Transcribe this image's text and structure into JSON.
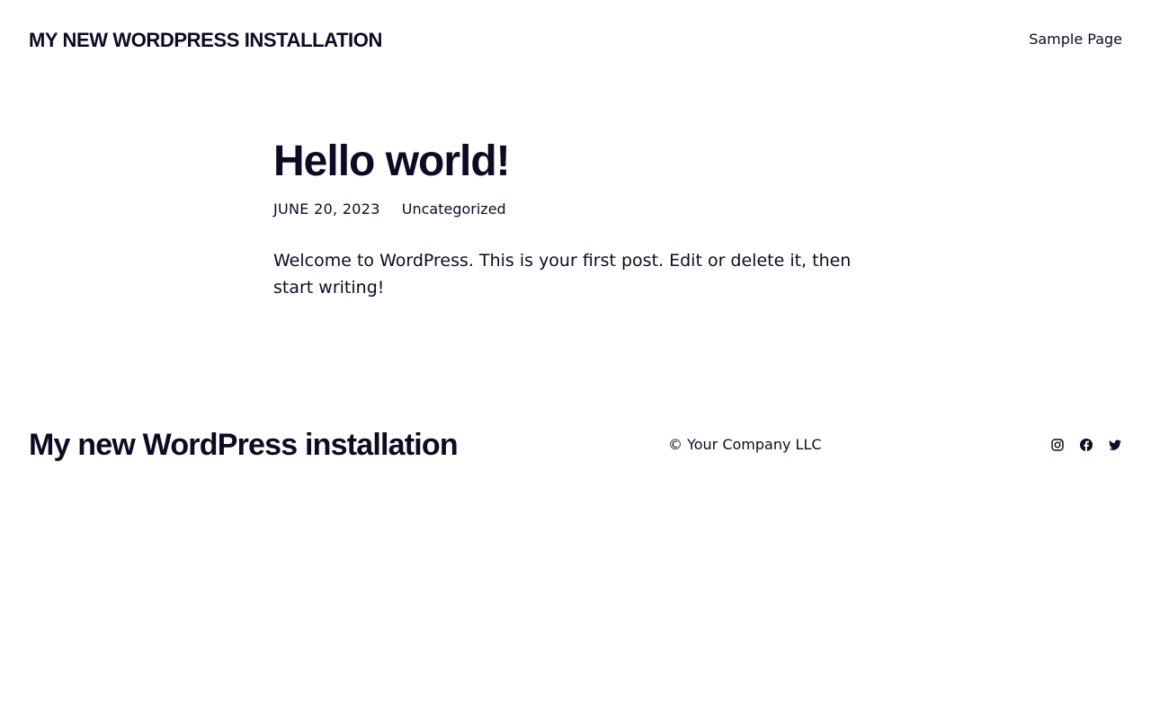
{
  "header": {
    "site_title": "MY NEW WORDPRESS INSTALLATION",
    "nav": [
      {
        "label": "Sample Page"
      }
    ]
  },
  "post": {
    "title": "Hello world!",
    "date": "JUNE 20, 2023",
    "category": "Uncategorized",
    "content": "Welcome to WordPress. This is your first post. Edit or delete it, then start writing!"
  },
  "footer": {
    "site_title": "My new WordPress installation",
    "copyright": "© Your Company LLC",
    "social": [
      {
        "icon": "instagram-icon"
      },
      {
        "icon": "facebook-icon"
      },
      {
        "icon": "twitter-icon"
      }
    ]
  },
  "colors": {
    "text": "#0b0b24",
    "background": "#ffffff"
  }
}
